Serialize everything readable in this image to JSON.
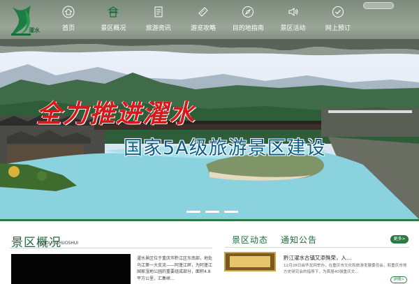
{
  "header": {
    "logo_text": "濯水",
    "nav": [
      {
        "label": "首页",
        "icon": "home-icon"
      },
      {
        "label": "景区概况",
        "icon": "pagoda-icon"
      },
      {
        "label": "旅游资讯",
        "icon": "news-icon"
      },
      {
        "label": "游览攻略",
        "icon": "ticket-icon"
      },
      {
        "label": "目的地指南",
        "icon": "compass-icon"
      },
      {
        "label": "景区活动",
        "icon": "speaker-icon"
      },
      {
        "label": "网上预订",
        "icon": "check-icon"
      }
    ]
  },
  "banner": {
    "slogan_main": "全力推进濯水",
    "slogan_sub": "国家5A级旅游景区建设",
    "slide_count": 3
  },
  "about": {
    "title": "景区概况",
    "title_en": "ABOUT ZHUOSHUI",
    "text": "濯水景区位于重庆市黔江区东南部，地处乌江第一大支流——阿蓬江畔，为阿蓬江国家湿地公园的重要组成部分，面积4.8平方公里，汇集峡…"
  },
  "news": {
    "tab_activity": "景区动态",
    "tab_notice": "通知公告",
    "more_label": "更多>",
    "item": {
      "title": "黔江濯水古镇又添殊荣，入…",
      "desc": "12月28日由华龙网举办，在重庆市文化和旅游发展委员会，和重庆市地方史研究会的指导下，为首届40强重庆文…",
      "detail_label": "详情>"
    }
  },
  "colors": {
    "brand_green": "#1d6b38",
    "slogan_red": "#d8191c",
    "slogan_blue": "#0d5f8a"
  }
}
